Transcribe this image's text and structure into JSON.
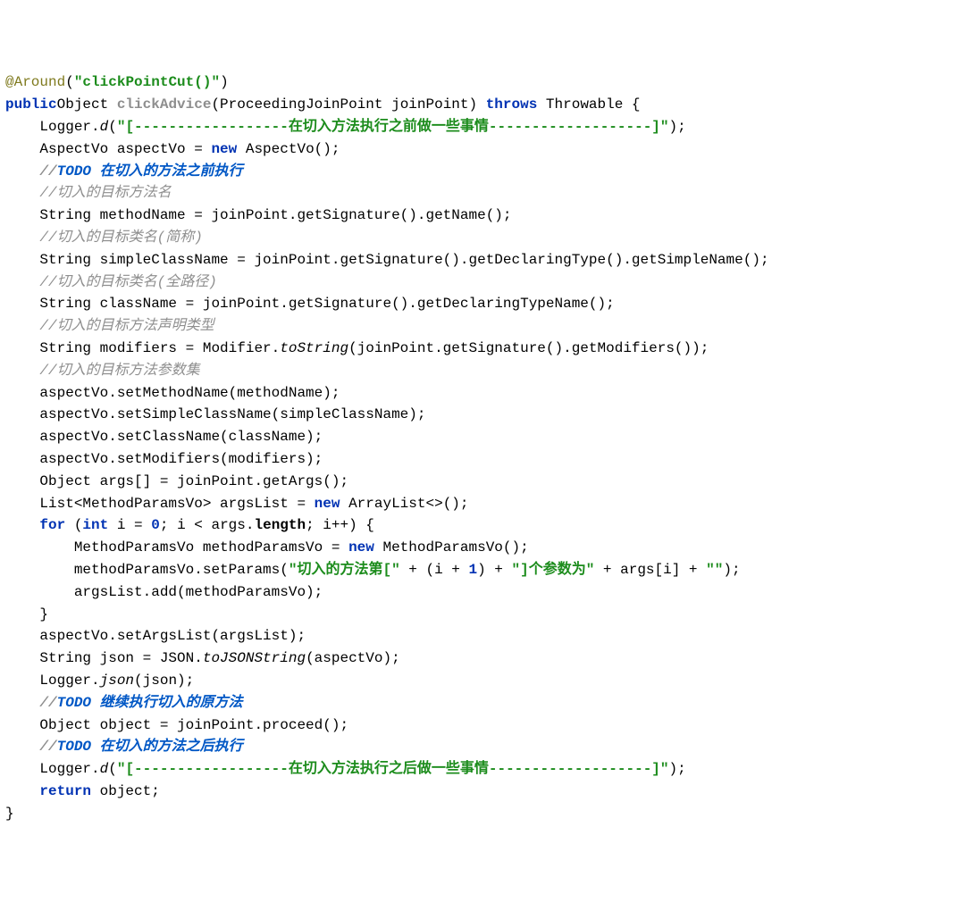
{
  "code": {
    "annotation": {
      "at": "@Around",
      "open": "(",
      "arg": "\"clickPointCut()\"",
      "close": ")"
    },
    "sig": {
      "pub": "public",
      "ret": "Object ",
      "name": "clickAdvice",
      "params": "(ProceedingJoinPoint joinPoint) ",
      "thr": "throws",
      "exc": " Throwable {"
    },
    "l1": {
      "a": "    Logger.",
      "b": "d",
      "c": "(",
      "d": "\"[------------------在切入方法执行之前做一些事情-------------------]\"",
      "e": ");"
    },
    "l2": {
      "a": "    AspectVo aspectVo = ",
      "b": "new",
      "c": " AspectVo();"
    },
    "l3": {
      "a": "    //",
      "b": "TODO 在切入的方法之前执行"
    },
    "l4": "    //切入的目标方法名",
    "l5": "    String methodName = joinPoint.getSignature().getName();",
    "l6": "    //切入的目标类名(简称)",
    "l7": "    String simpleClassName = joinPoint.getSignature().getDeclaringType().getSimpleName();",
    "l8": "    //切入的目标类名(全路径)",
    "l9": "    String className = joinPoint.getSignature().getDeclaringTypeName();",
    "l10": "    //切入的目标方法声明类型",
    "l11": {
      "a": "    String modifiers = Modifier.",
      "b": "toString",
      "c": "(joinPoint.getSignature().getModifiers());"
    },
    "l12": "    //切入的目标方法参数集",
    "l13": "    aspectVo.setMethodName(methodName);",
    "l14": "    aspectVo.setSimpleClassName(simpleClassName);",
    "l15": "    aspectVo.setClassName(className);",
    "l16": "    aspectVo.setModifiers(modifiers);",
    "l17": "    Object args[] = joinPoint.getArgs();",
    "l18": {
      "a": "    List<MethodParamsVo> argsList = ",
      "b": "new",
      "c": " ArrayList<>();"
    },
    "l19": {
      "a": "    ",
      "b": "for",
      "c": " (",
      "d": "int",
      "e": " i = ",
      "f": "0",
      "g": "; i < args.",
      "h": "length",
      "i": "; i++) {"
    },
    "l20": {
      "a": "        MethodParamsVo methodParamsVo = ",
      "b": "new",
      "c": " MethodParamsVo();"
    },
    "l21": {
      "a": "        methodParamsVo.setParams(",
      "b": "\"切入的方法第[\"",
      "c": " + (i + ",
      "d": "1",
      "e": ") + ",
      "f": "\"]个参数为\"",
      "g": " + args[i] + ",
      "h": "\"\"",
      "i": ");"
    },
    "l22": "        argsList.add(methodParamsVo);",
    "l23": "    }",
    "l24": "    aspectVo.setArgsList(argsList);",
    "l25": {
      "a": "    String json = JSON.",
      "b": "toJSONString",
      "c": "(aspectVo);"
    },
    "l26": {
      "a": "    Logger.",
      "b": "json",
      "c": "(json);"
    },
    "l27": {
      "a": "    //",
      "b": "TODO 继续执行切入的原方法"
    },
    "l28": "    Object object = joinPoint.proceed();",
    "l29": {
      "a": "    //",
      "b": "TODO 在切入的方法之后执行"
    },
    "l30": {
      "a": "    Logger.",
      "b": "d",
      "c": "(",
      "d": "\"[------------------在切入方法执行之后做一些事情-------------------]\"",
      "e": ");"
    },
    "l31": {
      "a": "    ",
      "b": "return",
      "c": " object;"
    },
    "l32": "}"
  }
}
